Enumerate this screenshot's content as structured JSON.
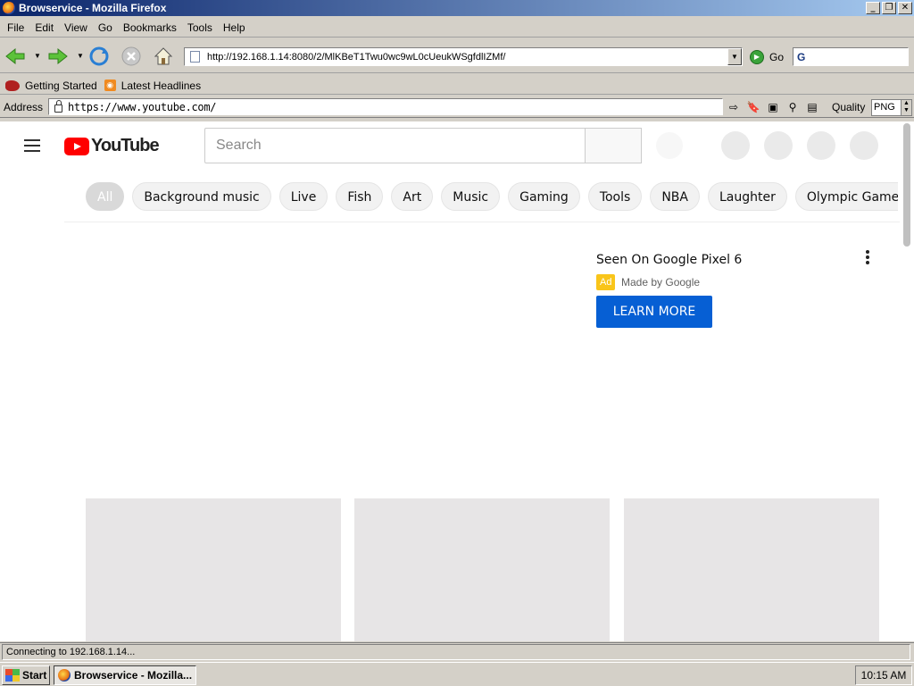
{
  "window": {
    "title": "Browservice - Mozilla Firefox"
  },
  "menu": {
    "items": [
      "File",
      "Edit",
      "View",
      "Go",
      "Bookmarks",
      "Tools",
      "Help"
    ]
  },
  "nav": {
    "url": "http://192.168.1.14:8080/2/MlKBeT1Twu0wc9wL0cUeukWSgfdlIZMf/",
    "go_label": "Go"
  },
  "bookmarks": {
    "items": [
      "Getting Started",
      "Latest Headlines"
    ]
  },
  "addressbar": {
    "label": "Address",
    "value": "https://www.youtube.com/",
    "quality_label": "Quality",
    "quality_value": "PNG"
  },
  "youtube": {
    "logo_text": "YouTube",
    "search_placeholder": "Search",
    "chips": [
      "All",
      "Background music",
      "Live",
      "Fish",
      "Art",
      "Music",
      "Gaming",
      "Tools",
      "NBA",
      "Laughter",
      "Olympic Games"
    ],
    "ad": {
      "title": "Seen On Google Pixel 6",
      "badge": "Ad",
      "advertiser": "Made by Google",
      "cta": "LEARN MORE"
    }
  },
  "status": {
    "text": "Connecting to 192.168.1.14..."
  },
  "taskbar": {
    "start_label": "Start",
    "task_label": "Browservice - Mozilla...",
    "clock": "10:15 AM"
  },
  "colors": {
    "youtube_red": "#ff0000",
    "cta_blue": "#065fd4",
    "ad_yellow": "#f9c51a",
    "titlebar": "#0a246a"
  }
}
